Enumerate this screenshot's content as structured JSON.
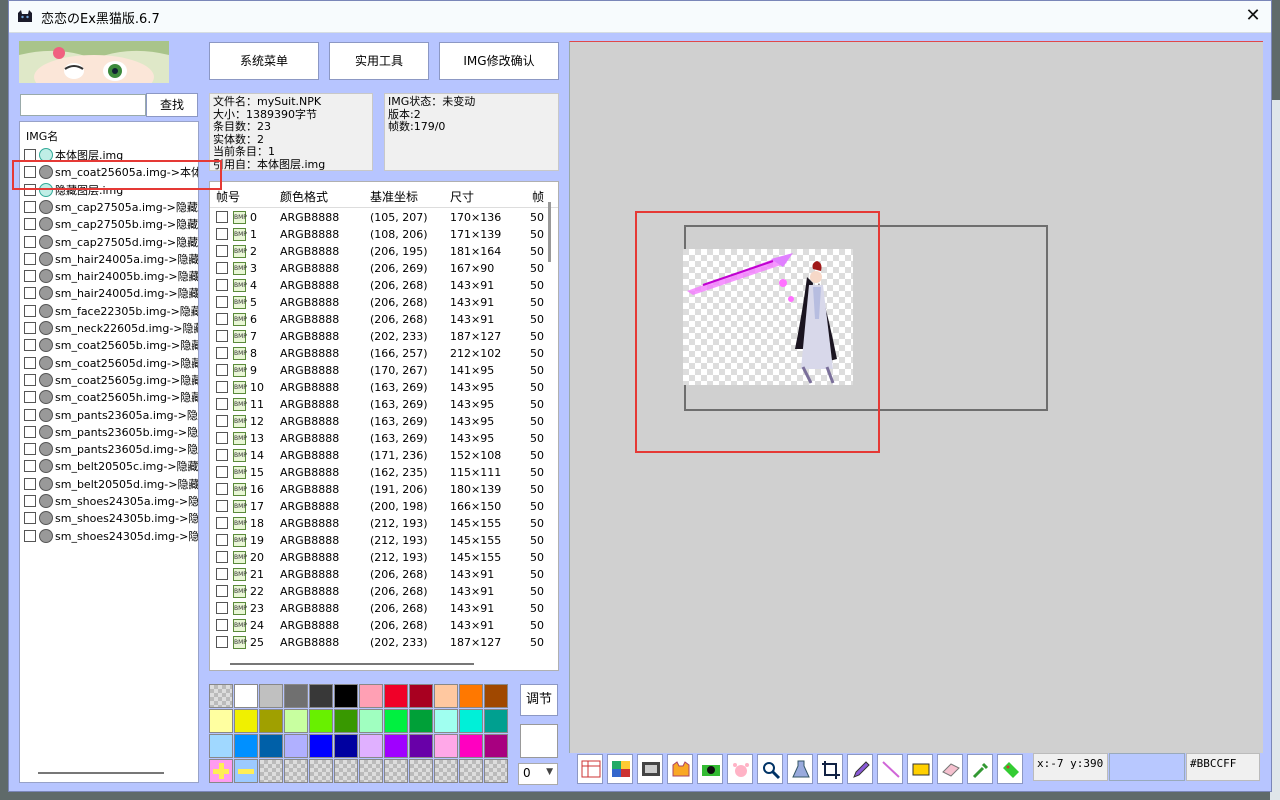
{
  "window": {
    "title": "恋恋のEx黑猫版.6.7",
    "close_glyph": "✕"
  },
  "search": {
    "placeholder": "",
    "button_label": "查找"
  },
  "img_list": {
    "header": "IMG名",
    "items": [
      {
        "label": "本体图层.img",
        "icon": "teal-cat-icon"
      },
      {
        "label": "sm_coat25605a.img->本体",
        "icon": "gray-cat-icon"
      },
      {
        "label": "隐藏图层.img",
        "icon": "teal-cat-icon"
      },
      {
        "label": "sm_cap27505a.img->隐藏.",
        "icon": "gray-cat-icon"
      },
      {
        "label": "sm_cap27505b.img->隐藏.",
        "icon": "gray-cat-icon"
      },
      {
        "label": "sm_cap27505d.img->隐藏.",
        "icon": "gray-cat-icon"
      },
      {
        "label": "sm_hair24005a.img->隐藏",
        "icon": "gray-cat-icon"
      },
      {
        "label": "sm_hair24005b.img->隐藏",
        "icon": "gray-cat-icon"
      },
      {
        "label": "sm_hair24005d.img->隐藏",
        "icon": "gray-cat-icon"
      },
      {
        "label": "sm_face22305b.img->隐藏",
        "icon": "gray-cat-icon"
      },
      {
        "label": "sm_neck22605d.img->隐藏",
        "icon": "gray-cat-icon"
      },
      {
        "label": "sm_coat25605b.img->隐藏",
        "icon": "gray-cat-icon"
      },
      {
        "label": "sm_coat25605d.img->隐藏",
        "icon": "gray-cat-icon"
      },
      {
        "label": "sm_coat25605g.img->隐藏",
        "icon": "gray-cat-icon"
      },
      {
        "label": "sm_coat25605h.img->隐藏",
        "icon": "gray-cat-icon"
      },
      {
        "label": "sm_pants23605a.img->隐.",
        "icon": "gray-cat-icon"
      },
      {
        "label": "sm_pants23605b.img->隐.",
        "icon": "gray-cat-icon"
      },
      {
        "label": "sm_pants23605d.img->隐.",
        "icon": "gray-cat-icon"
      },
      {
        "label": "sm_belt20505c.img->隐藏",
        "icon": "gray-cat-icon"
      },
      {
        "label": "sm_belt20505d.img->隐藏",
        "icon": "gray-cat-icon"
      },
      {
        "label": "sm_shoes24305a.img->隐.",
        "icon": "gray-cat-icon"
      },
      {
        "label": "sm_shoes24305b.img->隐.",
        "icon": "gray-cat-icon"
      },
      {
        "label": "sm_shoes24305d.img->隐.",
        "icon": "gray-cat-icon"
      }
    ]
  },
  "top_buttons": {
    "system_menu": "系统菜单",
    "tools": "实用工具",
    "img_confirm": "IMG修改确认"
  },
  "file_info": [
    "文件名：mySuit.NPK",
    "大小：1389390字节",
    "条目数：23",
    "实体数：2",
    "当前条目：1",
    "引用自：本体图层.img"
  ],
  "img_info": [
    "IMG状态：未变动",
    "版本:2",
    "帧数:179/0"
  ],
  "frames": {
    "headers": [
      "帧号",
      "颜色格式",
      "基准坐标",
      "尺寸",
      "帧"
    ],
    "rows": [
      [
        "0",
        "ARGB8888",
        "(105, 207)",
        "170×136",
        "50"
      ],
      [
        "1",
        "ARGB8888",
        "(108, 206)",
        "171×139",
        "50"
      ],
      [
        "2",
        "ARGB8888",
        "(206, 195)",
        "181×164",
        "50"
      ],
      [
        "3",
        "ARGB8888",
        "(206, 269)",
        "167×90",
        "50"
      ],
      [
        "4",
        "ARGB8888",
        "(206, 268)",
        "143×91",
        "50"
      ],
      [
        "5",
        "ARGB8888",
        "(206, 268)",
        "143×91",
        "50"
      ],
      [
        "6",
        "ARGB8888",
        "(206, 268)",
        "143×91",
        "50"
      ],
      [
        "7",
        "ARGB8888",
        "(202, 233)",
        "187×127",
        "50"
      ],
      [
        "8",
        "ARGB8888",
        "(166, 257)",
        "212×102",
        "50"
      ],
      [
        "9",
        "ARGB8888",
        "(170, 267)",
        "141×95",
        "50"
      ],
      [
        "10",
        "ARGB8888",
        "(163, 269)",
        "143×95",
        "50"
      ],
      [
        "11",
        "ARGB8888",
        "(163, 269)",
        "143×95",
        "50"
      ],
      [
        "12",
        "ARGB8888",
        "(163, 269)",
        "143×95",
        "50"
      ],
      [
        "13",
        "ARGB8888",
        "(163, 269)",
        "143×95",
        "50"
      ],
      [
        "14",
        "ARGB8888",
        "(171, 236)",
        "152×108",
        "50"
      ],
      [
        "15",
        "ARGB8888",
        "(162, 235)",
        "115×111",
        "50"
      ],
      [
        "16",
        "ARGB8888",
        "(191, 206)",
        "180×139",
        "50"
      ],
      [
        "17",
        "ARGB8888",
        "(200, 198)",
        "166×150",
        "50"
      ],
      [
        "18",
        "ARGB8888",
        "(212, 193)",
        "145×155",
        "50"
      ],
      [
        "19",
        "ARGB8888",
        "(212, 193)",
        "145×155",
        "50"
      ],
      [
        "20",
        "ARGB8888",
        "(212, 193)",
        "145×155",
        "50"
      ],
      [
        "21",
        "ARGB8888",
        "(206, 268)",
        "143×91",
        "50"
      ],
      [
        "22",
        "ARGB8888",
        "(206, 268)",
        "143×91",
        "50"
      ],
      [
        "23",
        "ARGB8888",
        "(206, 268)",
        "143×91",
        "50"
      ],
      [
        "24",
        "ARGB8888",
        "(206, 268)",
        "143×91",
        "50"
      ],
      [
        "25",
        "ARGB8888",
        "(202, 233)",
        "187×127",
        "50"
      ]
    ],
    "icon_text": "BMP"
  },
  "palette": {
    "rows": [
      [
        "checker",
        "#ffffff",
        "#c0c0c0",
        "#707070",
        "#383838",
        "#000000",
        "#ffa0b4",
        "#f00028",
        "#a80020",
        "#ffc8a0",
        "#ff7800",
        "#a04800"
      ],
      [
        "#ffffa0",
        "#f0f000",
        "#a0a000",
        "#c8ffa0",
        "#68f000",
        "#389800",
        "#a0ffc0",
        "#00f040",
        "#00a038",
        "#a0fff0",
        "#00f0d8",
        "#00a090"
      ],
      [
        "#a0d8ff",
        "#0090ff",
        "#0060a8",
        "#b0b0ff",
        "#0000ff",
        "#0000a0",
        "#e0b0ff",
        "#a000ff",
        "#6800a8",
        "#ffa8e8",
        "#ff00c0",
        "#a80080"
      ],
      [
        "add",
        "remove",
        "checker",
        "checker",
        "checker",
        "checker",
        "checker",
        "checker",
        "checker",
        "checker",
        "checker",
        "checker"
      ]
    ],
    "adjust_label": "调节",
    "alpha_value": "0"
  },
  "toolbar": {
    "tools": [
      "frame-grid-icon",
      "palette-split-icon",
      "film-icon",
      "cat-face-icon",
      "camera-icon",
      "paw-icon",
      "magnifier-icon",
      "flask-icon",
      "crop-icon",
      "pencil-icon",
      "line-icon",
      "rectangle-icon",
      "eraser-icon",
      "eyedropper-icon",
      "tag-icon"
    ],
    "coords": "x:-7 y:390",
    "color_code": "#BBCCFF"
  },
  "colors": {
    "panel_bg": "#b7c5ff",
    "highlight": "#e53935",
    "canvas_bg": "#d0d0d0"
  }
}
